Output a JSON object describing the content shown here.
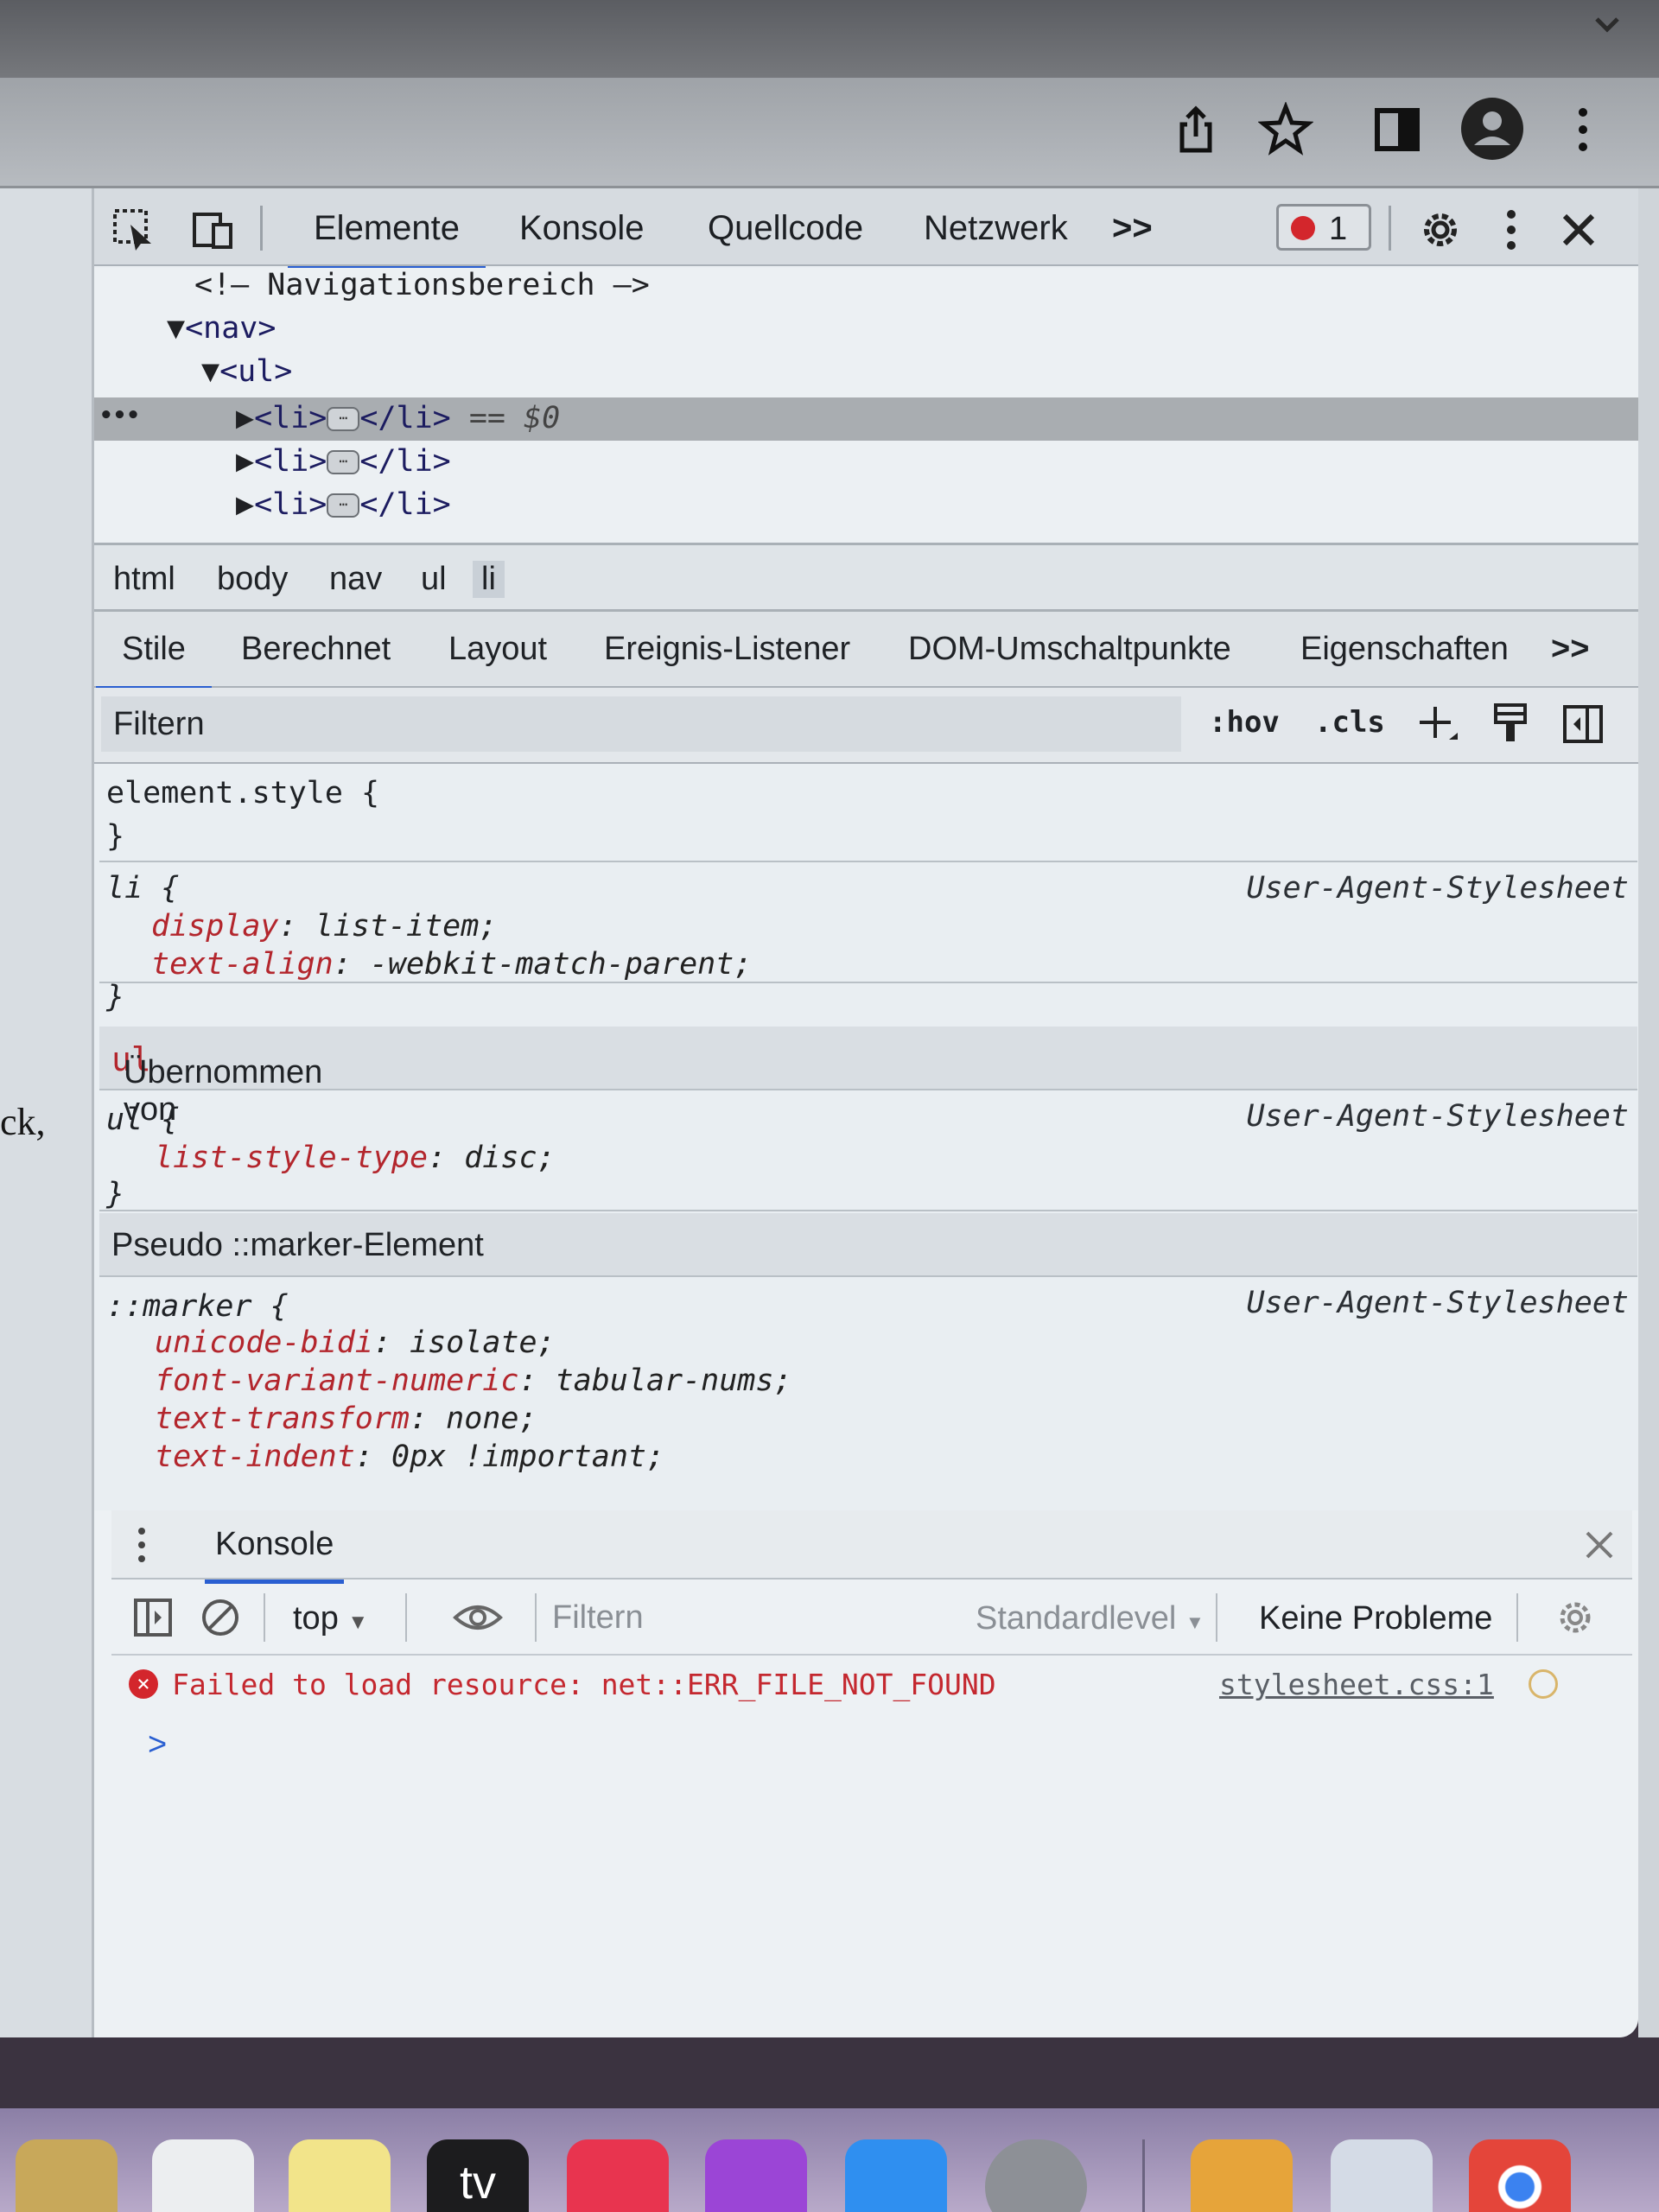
{
  "browser": {
    "icons": [
      "share-icon",
      "star-icon",
      "sidebar-icon",
      "profile-icon",
      "menu-icon"
    ]
  },
  "page": {
    "visible_text": "ck,"
  },
  "devtools": {
    "tabs": [
      "Elemente",
      "Konsole",
      "Quellcode",
      "Netzwerk"
    ],
    "more_tabs": ">>",
    "error_count": "1",
    "dom": {
      "comment": "<!— Navigationsbereich —>",
      "nav": "<nav>",
      "ul": "<ul>",
      "li_open": "<li>",
      "li_close": "</li>",
      "selected_suffix": "== $0",
      "ellipsis": "⋯"
    },
    "breadcrumb": [
      "html",
      "body",
      "nav",
      "ul",
      "li"
    ],
    "panel_tabs": [
      "Stile",
      "Berechnet",
      "Layout",
      "Ereignis-Listener",
      "DOM-Umschaltpunkte",
      "Eigenschaften"
    ],
    "panel_more": ">>",
    "filter_placeholder": "Filtern",
    "hov": ":hov",
    "cls": ".cls",
    "styles": {
      "element_style": "element.style {",
      "close_brace": "}",
      "li_selector": "li {",
      "ua_source": "User-Agent-Stylesheet",
      "li_props": [
        {
          "name": "display",
          "value": "list-item;"
        },
        {
          "name": "text-align",
          "value": "-webkit-match-parent;"
        }
      ],
      "inherited_label": "Übernommen von",
      "inherited_from": "ul",
      "ul_selector": "ul {",
      "ul_props": [
        {
          "name": "list-style-type",
          "value": "disc;"
        }
      ],
      "pseudo_label": "Pseudo ::marker-Element",
      "marker_selector": "::marker {",
      "marker_props": [
        {
          "name": "unicode-bidi",
          "value": "isolate;"
        },
        {
          "name": "font-variant-numeric",
          "value": "tabular-nums;"
        },
        {
          "name": "text-transform",
          "value": "none;"
        },
        {
          "name": "text-indent",
          "value": "0px !important;"
        }
      ]
    },
    "console": {
      "drawer_tab": "Konsole",
      "context": "top",
      "filter_placeholder": "Filtern",
      "level": "Standardlevel",
      "issues": "Keine Probleme",
      "error_message": "Failed to load resource: net::ERR_FILE_NOT_FOUND",
      "error_source": "stylesheet.css:1",
      "prompt": ">"
    }
  },
  "dock": {
    "apps": [
      "notes-app-icon",
      "reminders-app-icon",
      "stickies-app-icon",
      "apple-tv-app-icon",
      "music-app-icon",
      "podcasts-app-icon",
      "app-store-icon",
      "system-settings-icon",
      "books-app-icon",
      "preview-app-icon",
      "chrome-app-icon"
    ],
    "tv_label": "tv"
  },
  "colors": {
    "accent": "#2a5fd1",
    "error": "#c4282f",
    "css_property": "#b3262d"
  }
}
